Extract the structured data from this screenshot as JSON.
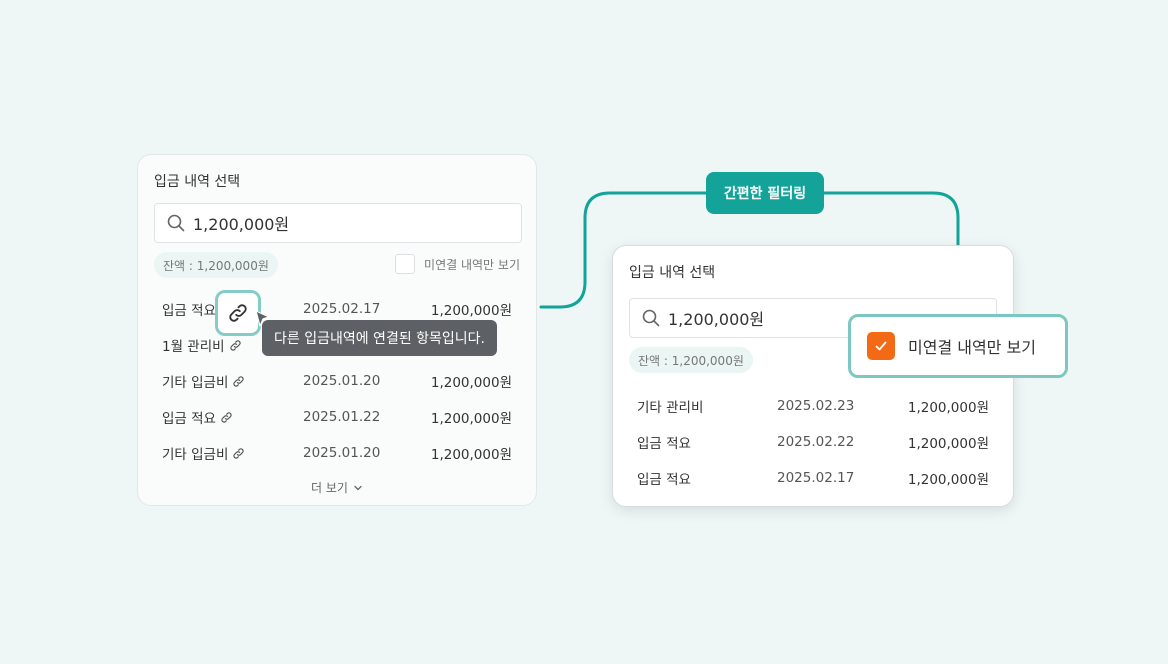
{
  "left_panel": {
    "title": "입금 내역 선택",
    "search": {
      "value": "1,200,000원"
    },
    "balance": "잔액 : 1,200,000원",
    "filter_label": "미연결 내역만 보기",
    "filter_checked": false,
    "rows": [
      {
        "desc": "입금 적요",
        "date": "2025.02.17",
        "amount": "1,200,000원",
        "linked": false
      },
      {
        "desc": "1월 관리비",
        "date": "",
        "amount": "",
        "linked": true
      },
      {
        "desc": "기타 입금비",
        "date": "2025.01.20",
        "amount": "1,200,000원",
        "linked": true
      },
      {
        "desc": "입금 적요",
        "date": "2025.01.22",
        "amount": "1,200,000원",
        "linked": true
      },
      {
        "desc": "기타 입금비",
        "date": "2025.01.20",
        "amount": "1,200,000원",
        "linked": true
      }
    ],
    "more_label": "더 보기",
    "tooltip": "다른 입금내역에 연결된 항목입니다."
  },
  "filter_badge": "간편한 필터링",
  "right_panel": {
    "title": "입금 내역 선택",
    "search": {
      "value": "1,200,000원"
    },
    "balance": "잔액 : 1,200,000원",
    "filter_label": "미연결 내역만 보기",
    "filter_checked": true,
    "rows": [
      {
        "desc": "기타 관리비",
        "date": "2025.02.23",
        "amount": "1,200,000원"
      },
      {
        "desc": "입금 적요",
        "date": "2025.02.22",
        "amount": "1,200,000원"
      },
      {
        "desc": "입금 적요",
        "date": "2025.02.17",
        "amount": "1,200,000원"
      }
    ]
  },
  "colors": {
    "accent": "#13a399",
    "highlight_border": "#7cc7c1",
    "checkbox_checked": "#f26a16",
    "tooltip_bg": "#5d6165",
    "page_bg": "#eef7f6"
  }
}
